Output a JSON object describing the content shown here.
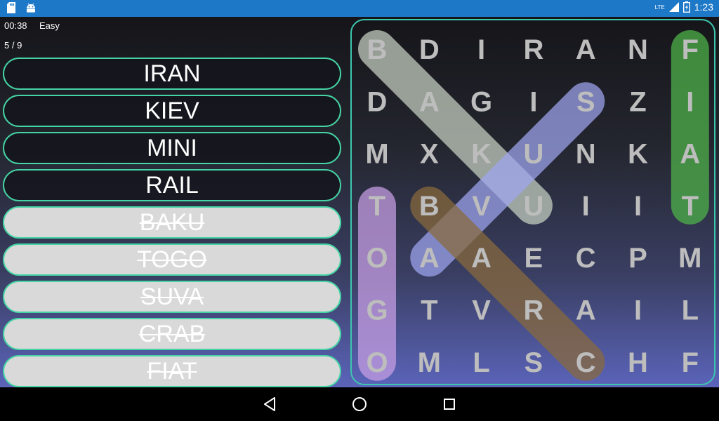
{
  "status_bar": {
    "left_icons": [
      "sd-card-icon",
      "android-icon"
    ],
    "network_label": "LTE",
    "time": "1:23"
  },
  "hud": {
    "timer": "00:38",
    "difficulty": "Easy",
    "progress": "5 / 9"
  },
  "words": [
    {
      "text": "IRAN",
      "found": false
    },
    {
      "text": "KIEV",
      "found": false
    },
    {
      "text": "MINI",
      "found": false
    },
    {
      "text": "RAIL",
      "found": false
    },
    {
      "text": "BAKU",
      "found": true
    },
    {
      "text": "TOGO",
      "found": true
    },
    {
      "text": "SUVA",
      "found": true
    },
    {
      "text": "CRAB",
      "found": true
    },
    {
      "text": "FIAT",
      "found": true
    }
  ],
  "grid": {
    "rows": [
      [
        "B",
        "D",
        "I",
        "R",
        "A",
        "N",
        "F"
      ],
      [
        "D",
        "A",
        "G",
        "I",
        "S",
        "Z",
        "I"
      ],
      [
        "M",
        "X",
        "K",
        "U",
        "N",
        "K",
        "A"
      ],
      [
        "T",
        "B",
        "V",
        "U",
        "I",
        "I",
        "T"
      ],
      [
        "O",
        "A",
        "A",
        "E",
        "C",
        "P",
        "M"
      ],
      [
        "G",
        "T",
        "V",
        "R",
        "A",
        "I",
        "L"
      ],
      [
        "O",
        "M",
        "L",
        "S",
        "C",
        "H",
        "F"
      ]
    ]
  },
  "highlights": [
    {
      "word": "BAKU",
      "from": [
        0,
        0
      ],
      "to": [
        3,
        3
      ],
      "color": "#c8d2c4"
    },
    {
      "word": "SUVA",
      "from": [
        1,
        4
      ],
      "to": [
        4,
        1
      ],
      "color": "#9fa6f0"
    },
    {
      "word": "CRAB",
      "from": [
        6,
        4
      ],
      "to": [
        3,
        1
      ],
      "color": "#8a6a3c"
    },
    {
      "word": "TOGO",
      "from": [
        3,
        0
      ],
      "to": [
        6,
        0
      ],
      "color": "#c9a0e6"
    },
    {
      "word": "FIAT",
      "from": [
        0,
        6
      ],
      "to": [
        3,
        6
      ],
      "color": "#4fb64a"
    }
  ],
  "colors": {
    "status_bar": "#1e78c8",
    "pill_border": "#45d4a4",
    "board_border": "#3cc6ae",
    "letter": "#bdbdbd"
  },
  "nav": [
    "back-icon",
    "home-icon",
    "recents-icon"
  ]
}
